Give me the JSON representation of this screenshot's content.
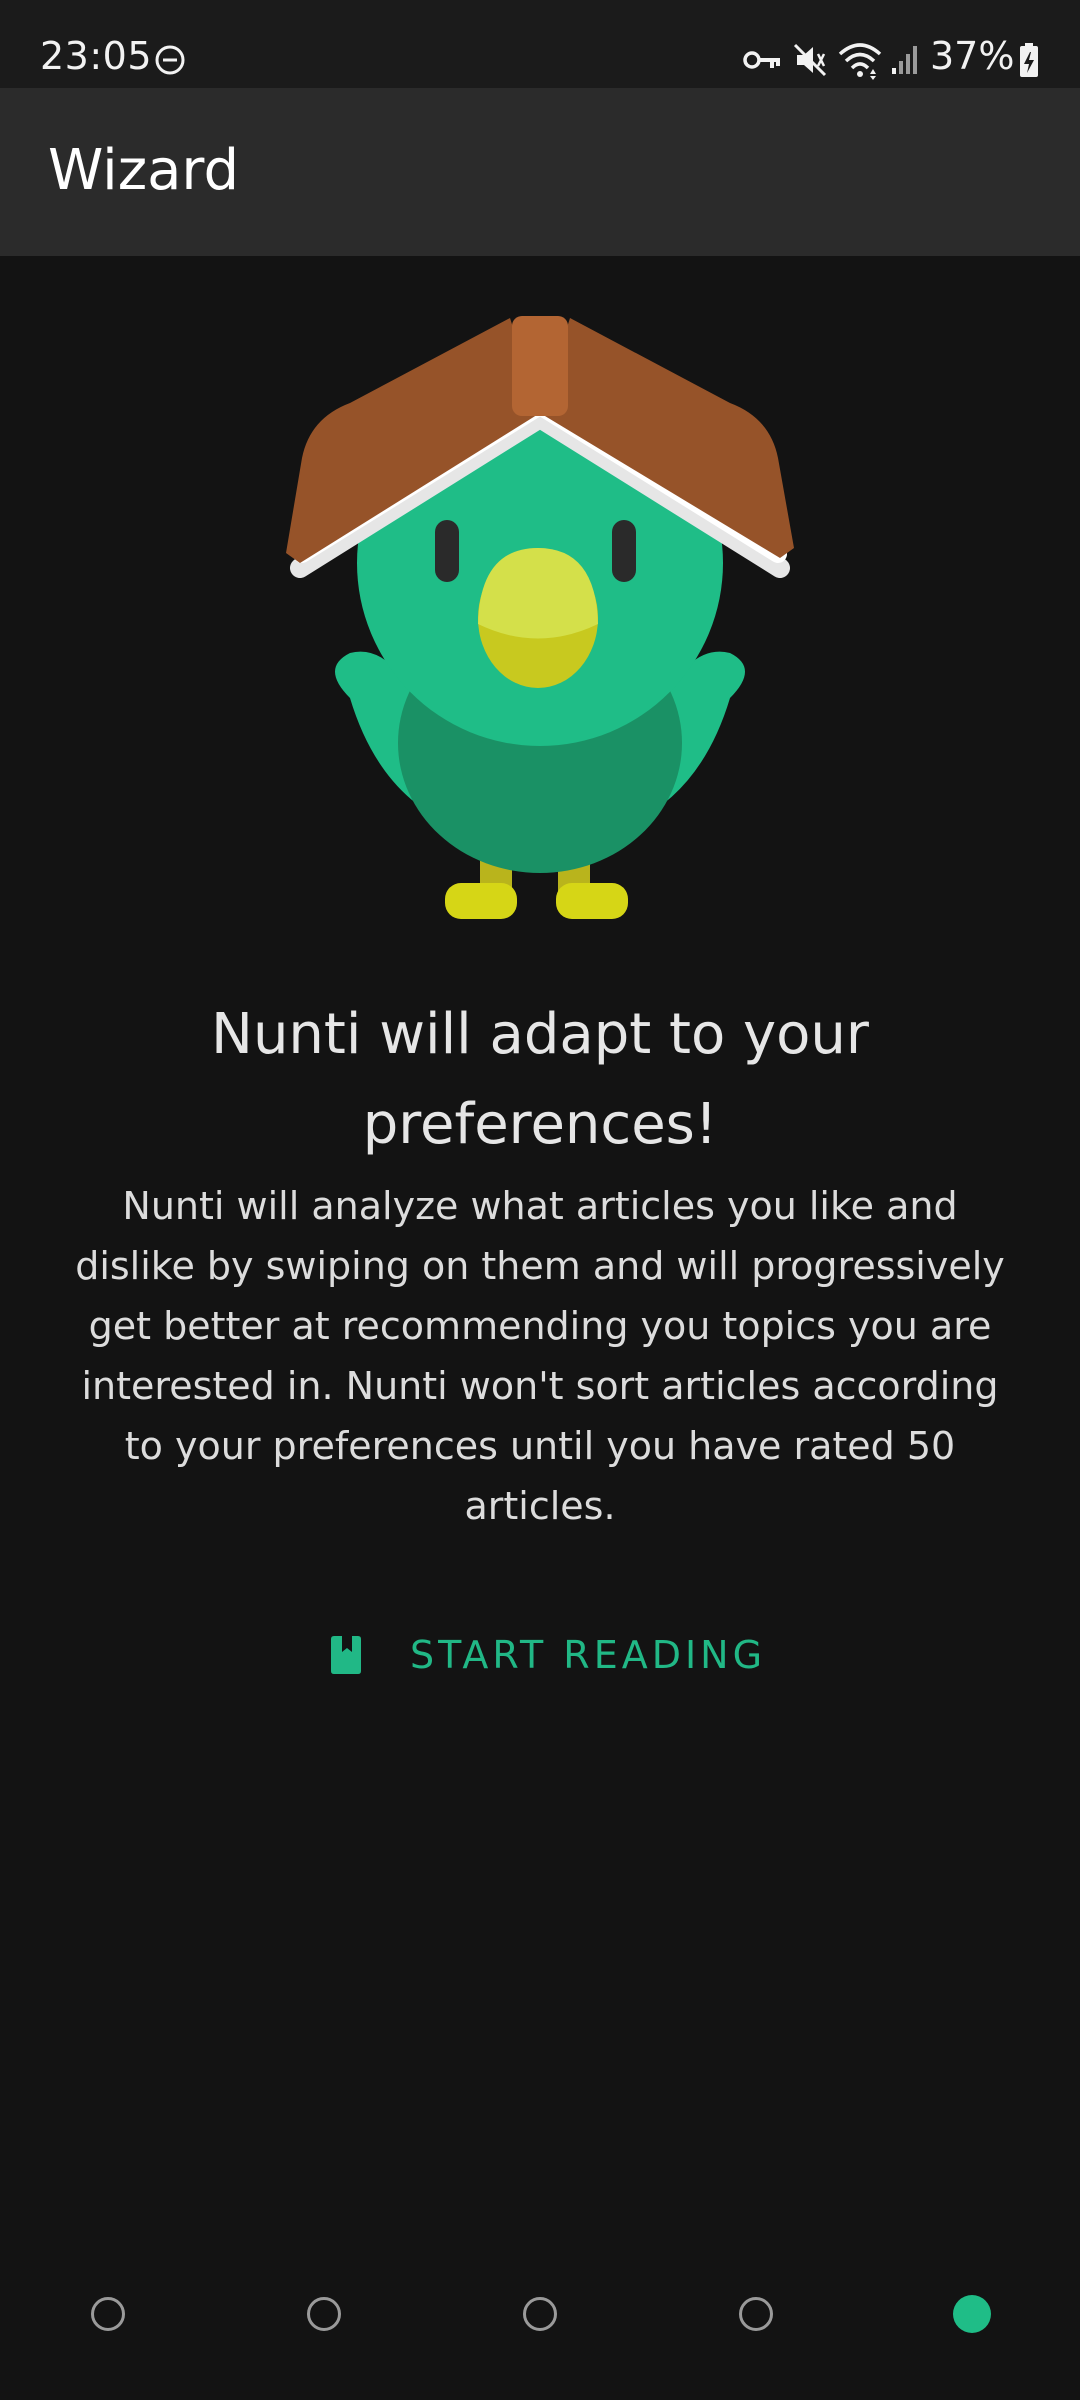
{
  "status_bar": {
    "time": "23:05",
    "battery": "37%",
    "icons": [
      "do-not-disturb-icon",
      "vpn-key-icon",
      "mute-icon",
      "wifi-icon",
      "signal-icon",
      "battery-charging-icon"
    ]
  },
  "app_bar": {
    "title": "Wizard"
  },
  "content": {
    "headline_line1": "Nunti will adapt to your",
    "headline_line2": "preferences!",
    "body_lines": [
      "Nunti will analyze what articles you like and",
      "dislike by swiping on them and will progressively",
      "get better at recommending you topics you are",
      "interested in. Nunti won't sort articles according",
      "to your preferences until you have rated 50",
      "articles."
    ]
  },
  "start_button": {
    "label": "START READING",
    "icon": "book-icon"
  },
  "pager": {
    "total": 5,
    "active_index": 4
  },
  "colors": {
    "accent": "#21b886",
    "background": "#131313",
    "app_bar": "#2b2b2b"
  }
}
